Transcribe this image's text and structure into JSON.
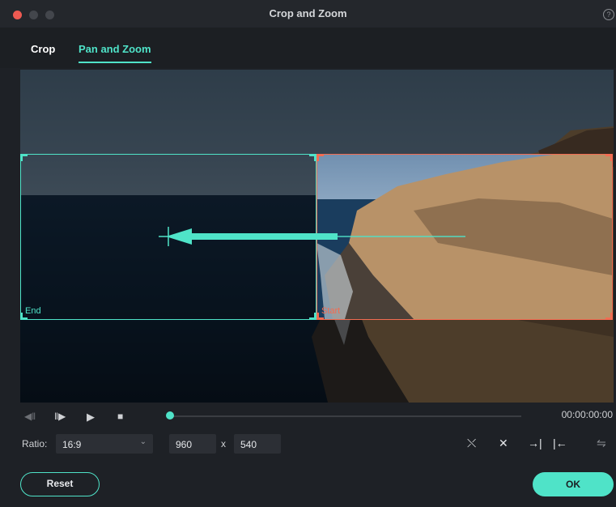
{
  "window": {
    "title": "Crop and Zoom",
    "help_icon": "?"
  },
  "tabs": [
    {
      "label": "Crop",
      "active": false
    },
    {
      "label": "Pan and Zoom",
      "active": true
    }
  ],
  "preview": {
    "end_label": "End",
    "start_label": "Start"
  },
  "playback": {
    "prev_icon": "◀‖",
    "next_icon": "‖▶",
    "play_icon": "▶",
    "stop_icon": "■",
    "timecode": "00:00:00:00"
  },
  "ratio": {
    "label": "Ratio:",
    "value": "16:9",
    "chevron": "⌄"
  },
  "size": {
    "width": "960",
    "separator": "x",
    "height": "540"
  },
  "tools": {
    "fit_icon": "⤬",
    "full_icon": "✕",
    "set_start_icon": "→|",
    "set_end_icon": "|←",
    "swap_icon": "⇋"
  },
  "buttons": {
    "reset": "Reset",
    "ok": "OK"
  },
  "colors": {
    "accent": "#4fe3c8",
    "start": "#f26c52",
    "close": "#ee5a52"
  }
}
